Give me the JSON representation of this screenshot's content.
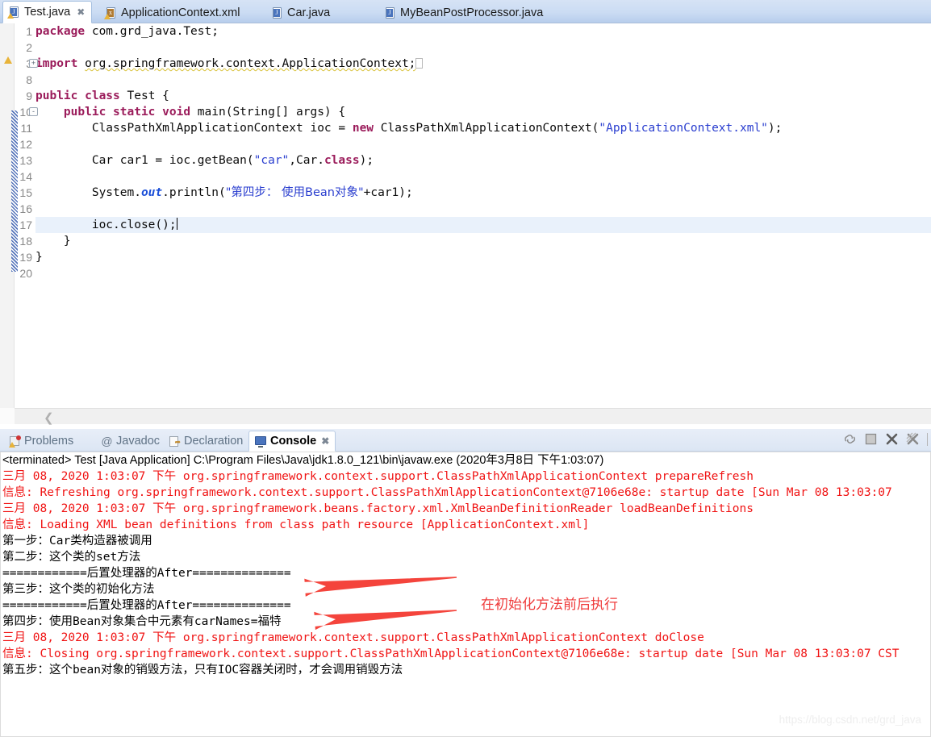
{
  "editor": {
    "tabs": [
      {
        "label": "Test.java",
        "icon": "java-file-icon",
        "active": true,
        "closable": true,
        "warning": true
      },
      {
        "label": "ApplicationContext.xml",
        "icon": "xml-file-icon",
        "active": false,
        "closable": false,
        "warning": true
      },
      {
        "label": "Car.java",
        "icon": "java-file-icon",
        "active": false,
        "closable": false,
        "warning": false
      },
      {
        "label": "MyBeanPostProcessor.java",
        "icon": "java-file-icon",
        "active": false,
        "closable": false,
        "warning": false
      }
    ],
    "scroll_left_icon": "chevron-left-icon",
    "lines": [
      {
        "no": "1",
        "segments": [
          {
            "t": "package ",
            "c": "kw"
          },
          {
            "t": "com.grd_java.Test;",
            "c": "plain"
          }
        ]
      },
      {
        "no": "2",
        "segments": []
      },
      {
        "no": "3",
        "fold": "+",
        "marker": "warning-marker",
        "segments": [
          {
            "t": "import ",
            "c": "kw"
          },
          {
            "t": "org.springframework.context.ApplicationContext;",
            "c": "imp"
          },
          {
            "t": "⎕",
            "c": "phantom"
          }
        ]
      },
      {
        "no": "8",
        "segments": []
      },
      {
        "no": "9",
        "segments": [
          {
            "t": "public class ",
            "c": "kw"
          },
          {
            "t": "Test {",
            "c": "plain"
          }
        ]
      },
      {
        "no": "10",
        "fold": "-",
        "segments": [
          {
            "t": "    ",
            "c": "plain"
          },
          {
            "t": "public static void ",
            "c": "kw"
          },
          {
            "t": "main(String[] args) {",
            "c": "plain"
          }
        ]
      },
      {
        "no": "11",
        "segments": [
          {
            "t": "        ClassPathXmlApplicationContext ioc = ",
            "c": "plain"
          },
          {
            "t": "new ",
            "c": "kw"
          },
          {
            "t": "ClassPathXmlApplicationContext(",
            "c": "plain"
          },
          {
            "t": "\"ApplicationContext.xml\"",
            "c": "str"
          },
          {
            "t": ");",
            "c": "plain"
          }
        ]
      },
      {
        "no": "12",
        "segments": []
      },
      {
        "no": "13",
        "segments": [
          {
            "t": "        Car car1 = ioc.getBean(",
            "c": "plain"
          },
          {
            "t": "\"car\"",
            "c": "str"
          },
          {
            "t": ",Car.",
            "c": "plain"
          },
          {
            "t": "class",
            "c": "kw"
          },
          {
            "t": ");",
            "c": "plain"
          }
        ]
      },
      {
        "no": "14",
        "segments": []
      },
      {
        "no": "15",
        "segments": [
          {
            "t": "        System.",
            "c": "plain"
          },
          {
            "t": "out",
            "c": "fld"
          },
          {
            "t": ".println(",
            "c": "plain"
          },
          {
            "t": "\"第四步： 使用Bean对象\"",
            "c": "str"
          },
          {
            "t": "+car1);",
            "c": "plain"
          }
        ]
      },
      {
        "no": "16",
        "segments": []
      },
      {
        "no": "17",
        "highlight": true,
        "caret": true,
        "segments": [
          {
            "t": "        ioc.close();",
            "c": "plain"
          }
        ]
      },
      {
        "no": "18",
        "segments": [
          {
            "t": "    }",
            "c": "plain"
          }
        ]
      },
      {
        "no": "19",
        "segments": [
          {
            "t": "}",
            "c": "plain"
          }
        ]
      },
      {
        "no": "20",
        "segments": []
      }
    ]
  },
  "console_panel": {
    "tabs": [
      {
        "label": "Problems",
        "icon": "problems-icon",
        "active": false
      },
      {
        "label": "Javadoc",
        "icon": "javadoc-at-icon",
        "active": false
      },
      {
        "label": "Declaration",
        "icon": "declaration-icon",
        "active": false
      },
      {
        "label": "Console",
        "icon": "console-icon",
        "active": true,
        "closable": true
      }
    ],
    "toolbar": [
      {
        "name": "pin-console-icon"
      },
      {
        "name": "terminate-icon"
      },
      {
        "name": "remove-launch-icon"
      },
      {
        "name": "remove-all-terminated-icon"
      }
    ],
    "header": "<terminated> Test [Java Application] C:\\Program Files\\Java\\jdk1.8.0_121\\bin\\javaw.exe (2020年3月8日 下午1:03:07)",
    "output": [
      {
        "color": "red",
        "text": "三月 08, 2020 1:03:07 下午 org.springframework.context.support.ClassPathXmlApplicationContext prepareRefresh"
      },
      {
        "color": "red",
        "text": "信息: Refreshing org.springframework.context.support.ClassPathXmlApplicationContext@7106e68e: startup date [Sun Mar 08 13:03:07"
      },
      {
        "color": "red",
        "text": "三月 08, 2020 1:03:07 下午 org.springframework.beans.factory.xml.XmlBeanDefinitionReader loadBeanDefinitions"
      },
      {
        "color": "red",
        "text": "信息: Loading XML bean definitions from class path resource [ApplicationContext.xml]"
      },
      {
        "color": "black",
        "text": "第一步：Car类构造器被调用"
      },
      {
        "color": "black",
        "text": "第二步：这个类的set方法"
      },
      {
        "color": "black",
        "text": "============后置处理器的After=============="
      },
      {
        "color": "black",
        "text": "第三步：这个类的初始化方法"
      },
      {
        "color": "black",
        "text": "============后置处理器的After=============="
      },
      {
        "color": "black",
        "text": "第四步：使用Bean对象集合中元素有carNames=福特"
      },
      {
        "color": "red",
        "text": "三月 08, 2020 1:03:07 下午 org.springframework.context.support.ClassPathXmlApplicationContext doClose"
      },
      {
        "color": "red",
        "text": "信息: Closing org.springframework.context.support.ClassPathXmlApplicationContext@7106e68e: startup date [Sun Mar 08 13:03:07 CST"
      },
      {
        "color": "black",
        "text": "第五步：这个bean对象的销毁方法，只有IOC容器关闭时，才会调用销毁方法"
      }
    ]
  },
  "annotations": {
    "note_text": "在初始化方法前后执行",
    "note_color": "#ef3b3b",
    "arrow_color": "#f4443c",
    "arrow_count": 2
  },
  "watermark": {
    "text": "https://blog.csdn.net/grd_java"
  }
}
